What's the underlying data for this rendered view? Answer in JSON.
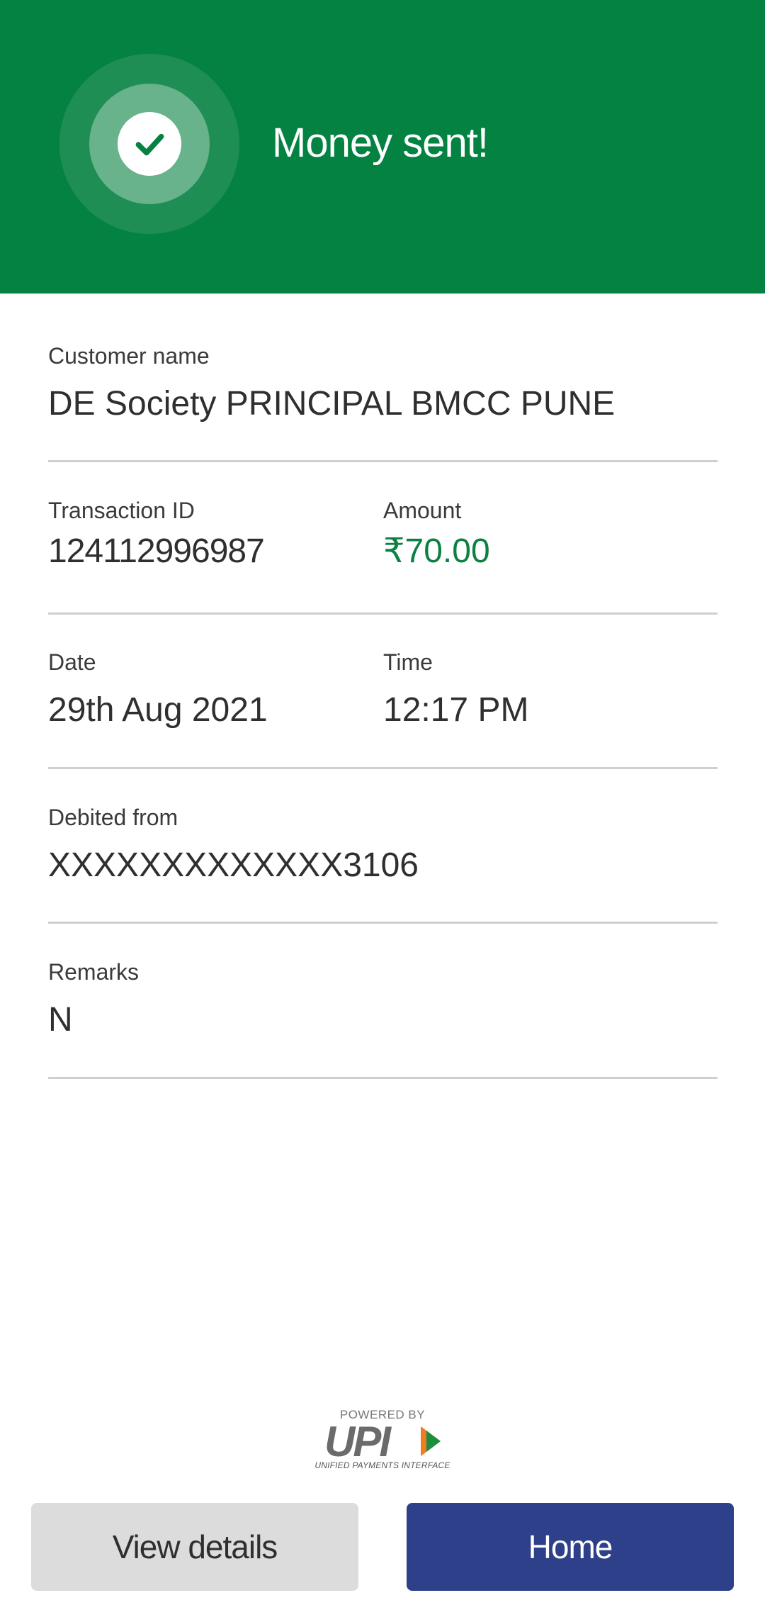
{
  "header": {
    "title": "Money sent!",
    "icon": "check-circle-icon",
    "background_color": "#038242"
  },
  "details": {
    "customer_name": {
      "label": "Customer name",
      "value": "DE Society PRINCIPAL BMCC PUNE"
    },
    "transaction_id": {
      "label": "Transaction ID",
      "value": "124112996987"
    },
    "amount": {
      "label": "Amount",
      "value": "₹70.00",
      "color": "#0d8043"
    },
    "date": {
      "label": "Date",
      "value": "29th Aug 2021"
    },
    "time": {
      "label": "Time",
      "value": "12:17 PM"
    },
    "debited_from": {
      "label": "Debited from",
      "value": "XXXXXXXXXXXXX3106"
    },
    "remarks": {
      "label": "Remarks",
      "value": "N"
    }
  },
  "footer": {
    "powered_by": "POWERED BY",
    "logo_text": "UPI",
    "logo_subtitle": "UNIFIED PAYMENTS INTERFACE"
  },
  "buttons": {
    "view_details": "View details",
    "home": "Home",
    "home_color": "#2e4089"
  }
}
